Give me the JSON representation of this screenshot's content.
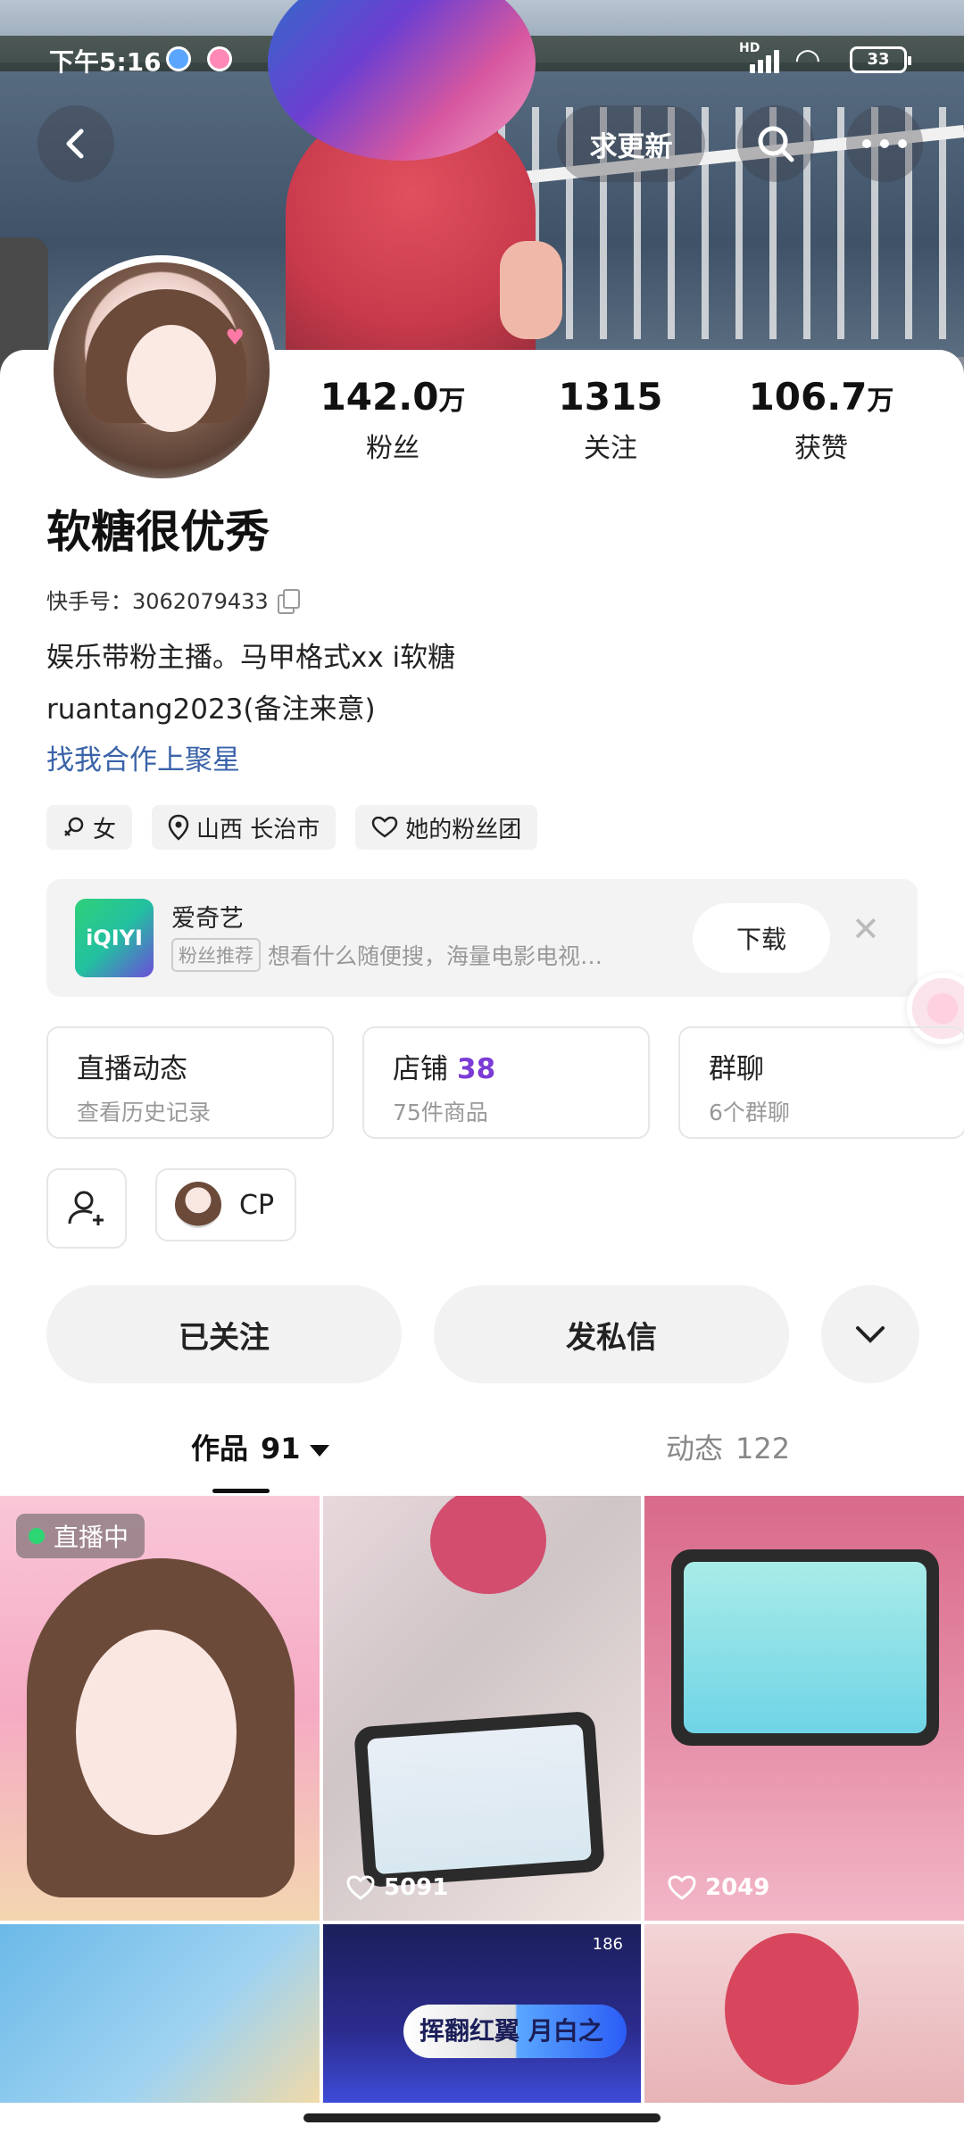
{
  "status_bar": {
    "time": "下午5:16",
    "battery": "33",
    "network": "HD"
  },
  "header": {
    "update_button": "求更新"
  },
  "profile": {
    "name": "软糖很优秀",
    "kuaishou_id": "快手号：3062079433",
    "bio_line1": "娱乐带粉主播。马甲格式xx   i软糖",
    "bio_line2": "ruantang2023(备注来意)",
    "link": "找我合作上聚星",
    "stats": [
      {
        "num": "142.0",
        "unit": "万",
        "label": "粉丝"
      },
      {
        "num": "1315",
        "unit": "",
        "label": "关注"
      },
      {
        "num": "106.7",
        "unit": "万",
        "label": "获赞"
      }
    ],
    "tags": [
      "女",
      "山西 长治市",
      "她的粉丝团"
    ]
  },
  "ad": {
    "logo_text": "iQIYI",
    "title": "爱奇艺",
    "badge": "粉丝推荐",
    "desc": "想看什么随便搜，海量电影电视…",
    "download": "下载"
  },
  "features": [
    {
      "title": "直播动态",
      "num": "",
      "sub": "查看历史记录"
    },
    {
      "title": "店铺",
      "num": "38",
      "sub": "75件商品"
    },
    {
      "title": "群聊",
      "num": "",
      "sub": "6个群聊"
    }
  ],
  "cp_label": "CP",
  "actions": {
    "followed": "已关注",
    "message": "发私信"
  },
  "tabs": [
    {
      "label": "作品",
      "count": "91"
    },
    {
      "label": "动态",
      "count": "122"
    }
  ],
  "grid": {
    "live_label": "直播中",
    "likes": [
      "5091",
      "2049"
    ],
    "banner_text": "挥翻红翼 月白之",
    "coin_count": "186"
  }
}
